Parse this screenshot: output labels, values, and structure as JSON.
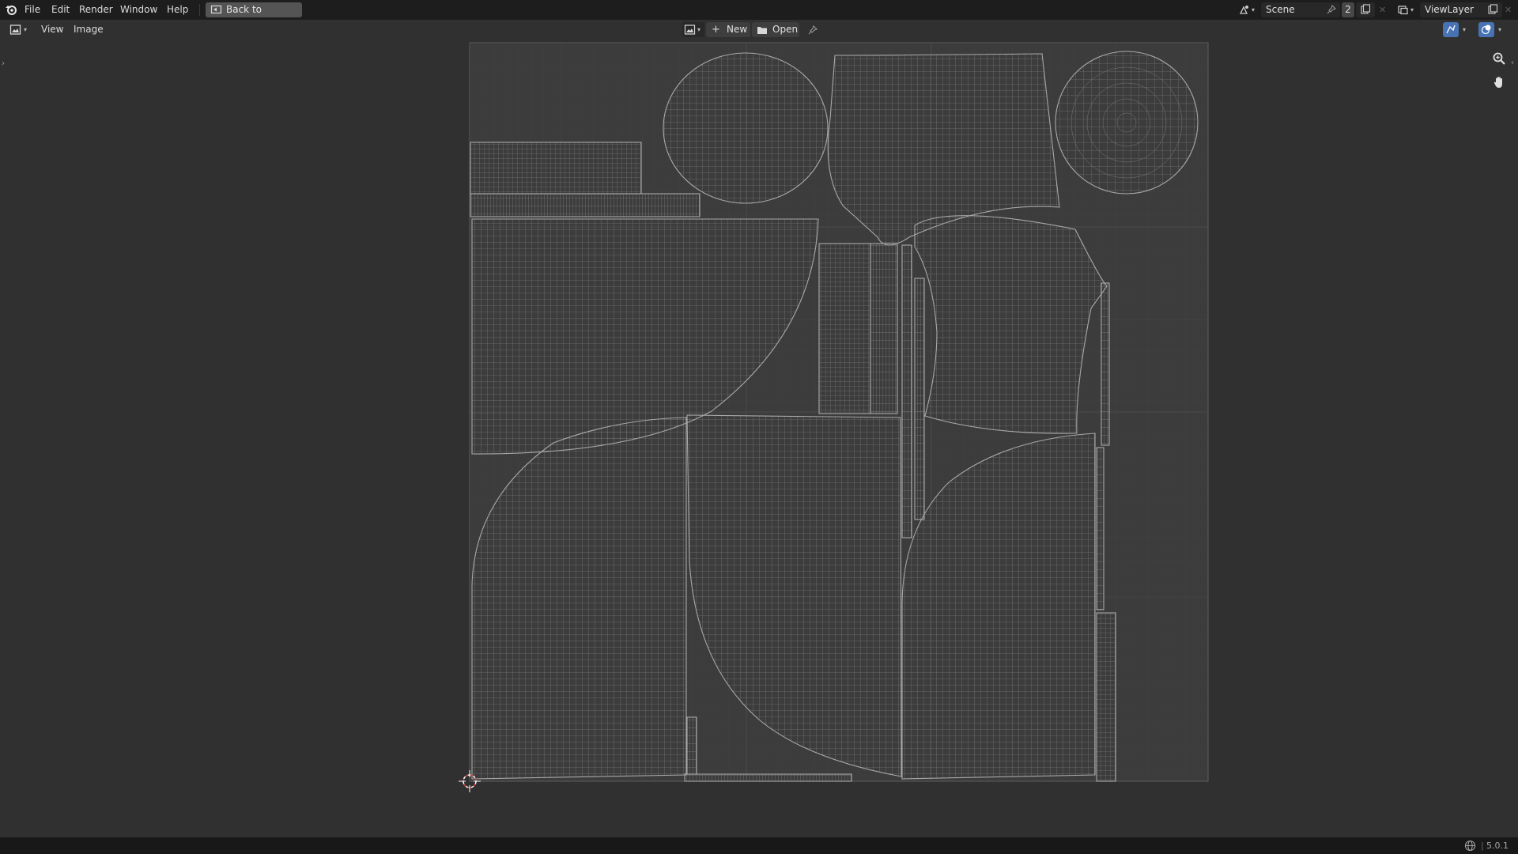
{
  "menu": {
    "file": "File",
    "edit": "Edit",
    "render": "Render",
    "window": "Window",
    "help": "Help"
  },
  "back_button": "Back to Previous",
  "scene": {
    "name": "Scene",
    "user_count": "2"
  },
  "view_layer": {
    "name": "ViewLayer"
  },
  "editor_header": {
    "view": "View",
    "image": "Image",
    "new": "New",
    "open": "Open"
  },
  "status": {
    "version": "5.0.1"
  },
  "colors": {
    "topbar": "#1d1d1d",
    "editor_bg": "#303030",
    "canvas_bg": "#3c3c3c",
    "uv_wire": "#9a9a9a",
    "accent_blue": "#4772b3"
  },
  "icons": {
    "app": "blender-logo-icon",
    "back": "back-to-previous-icon",
    "scene": "scene-icon",
    "view_layer": "view-layer-icon",
    "editor_type": "image-editor-icon",
    "new": "plus-icon",
    "open": "folder-icon",
    "pin": "pin-icon",
    "zoom": "zoom-icon",
    "pan": "hand-icon",
    "cursor": "2d-cursor-icon"
  }
}
